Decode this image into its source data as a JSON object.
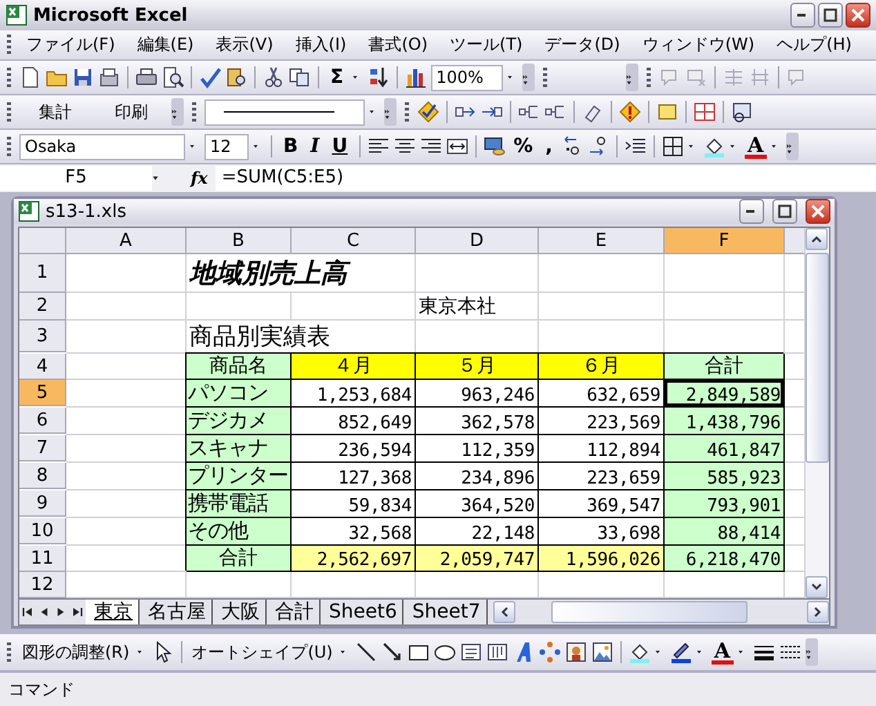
{
  "window": {
    "title": "Microsoft Excel"
  },
  "menu": [
    {
      "label": "ファイル(F)"
    },
    {
      "label": "編集(E)"
    },
    {
      "label": "表示(V)"
    },
    {
      "label": "挿入(I)"
    },
    {
      "label": "書式(O)"
    },
    {
      "label": "ツール(T)"
    },
    {
      "label": "データ(D)"
    },
    {
      "label": "ウィンドウ(W)"
    },
    {
      "label": "ヘルプ(H)"
    }
  ],
  "standard_toolbar": {
    "autosum": "Σ",
    "zoom": "100%"
  },
  "custom_toolbar": {
    "buttons": [
      "集計",
      "印刷"
    ]
  },
  "formatting_toolbar": {
    "font": "Osaka",
    "size": "12",
    "style_buttons": [
      "B",
      "I",
      "U"
    ],
    "percent": "%",
    "comma": ",",
    "font_color": "A"
  },
  "formula_bar": {
    "name_box": "F5",
    "fx": "fx",
    "formula": "=SUM(C5:E5)"
  },
  "workbook": {
    "title": "s13-1.xls",
    "columns": [
      {
        "label": "A",
        "selected": false
      },
      {
        "label": "B",
        "selected": false
      },
      {
        "label": "C",
        "selected": false
      },
      {
        "label": "D",
        "selected": false
      },
      {
        "label": "E",
        "selected": false
      },
      {
        "label": "F",
        "selected": true
      }
    ],
    "rows": [
      {
        "header": "1",
        "selected": false,
        "cells": [
          null,
          {
            "text": "地域別売上高",
            "kind": "title"
          },
          null,
          null,
          null,
          null
        ]
      },
      {
        "header": "2",
        "selected": false,
        "cells": [
          null,
          null,
          null,
          {
            "text": "東京本社",
            "kind": "text"
          },
          null,
          null
        ]
      },
      {
        "header": "3",
        "selected": false,
        "cells": [
          null,
          {
            "text": "商品別実績表",
            "kind": "subtitle"
          },
          null,
          null,
          null,
          null
        ]
      },
      {
        "header": "4",
        "selected": false,
        "cells": [
          null,
          {
            "text": "商品名",
            "kind": "heading",
            "color": "#ccffcc"
          },
          {
            "text": "４月",
            "kind": "heading",
            "color": "#ffff00"
          },
          {
            "text": "５月",
            "kind": "heading",
            "color": "#ffff00"
          },
          {
            "text": "６月",
            "kind": "heading",
            "color": "#ffff00"
          },
          {
            "text": "合計",
            "kind": "heading",
            "color": "#ccffcc"
          }
        ]
      },
      {
        "header": "5",
        "selected": true,
        "cells": [
          null,
          {
            "text": "パソコン",
            "kind": "label",
            "color": "#ccffcc"
          },
          {
            "text": "1,253,684",
            "kind": "number"
          },
          {
            "text": "963,246",
            "kind": "number"
          },
          {
            "text": "632,659",
            "kind": "number"
          },
          {
            "text": "2,849,589",
            "kind": "number",
            "color": "#ccffcc"
          }
        ]
      },
      {
        "header": "6",
        "selected": false,
        "cells": [
          null,
          {
            "text": "デジカメ",
            "kind": "label",
            "color": "#ccffcc"
          },
          {
            "text": "852,649",
            "kind": "number"
          },
          {
            "text": "362,578",
            "kind": "number"
          },
          {
            "text": "223,569",
            "kind": "number"
          },
          {
            "text": "1,438,796",
            "kind": "number",
            "color": "#ccffcc"
          }
        ]
      },
      {
        "header": "7",
        "selected": false,
        "cells": [
          null,
          {
            "text": "スキャナ",
            "kind": "label",
            "color": "#ccffcc"
          },
          {
            "text": "236,594",
            "kind": "number"
          },
          {
            "text": "112,359",
            "kind": "number"
          },
          {
            "text": "112,894",
            "kind": "number"
          },
          {
            "text": "461,847",
            "kind": "number",
            "color": "#ccffcc"
          }
        ]
      },
      {
        "header": "8",
        "selected": false,
        "cells": [
          null,
          {
            "text": "プリンター",
            "kind": "label",
            "color": "#ccffcc"
          },
          {
            "text": "127,368",
            "kind": "number"
          },
          {
            "text": "234,896",
            "kind": "number"
          },
          {
            "text": "223,659",
            "kind": "number"
          },
          {
            "text": "585,923",
            "kind": "number",
            "color": "#ccffcc"
          }
        ]
      },
      {
        "header": "9",
        "selected": false,
        "cells": [
          null,
          {
            "text": "携帯電話",
            "kind": "label",
            "color": "#ccffcc"
          },
          {
            "text": "59,834",
            "kind": "number"
          },
          {
            "text": "364,520",
            "kind": "number"
          },
          {
            "text": "369,547",
            "kind": "number"
          },
          {
            "text": "793,901",
            "kind": "number",
            "color": "#ccffcc"
          }
        ]
      },
      {
        "header": "10",
        "selected": false,
        "cells": [
          null,
          {
            "text": "その他",
            "kind": "label",
            "color": "#ccffcc"
          },
          {
            "text": "32,568",
            "kind": "number"
          },
          {
            "text": "22,148",
            "kind": "number"
          },
          {
            "text": "33,698",
            "kind": "number"
          },
          {
            "text": "88,414",
            "kind": "number",
            "color": "#ccffcc"
          }
        ]
      },
      {
        "header": "11",
        "selected": false,
        "cells": [
          null,
          {
            "text": "合計",
            "kind": "heading",
            "color": "#ccffcc"
          },
          {
            "text": "2,562,697",
            "kind": "number",
            "color": "#ffff99"
          },
          {
            "text": "2,059,747",
            "kind": "number",
            "color": "#ffff99"
          },
          {
            "text": "1,596,026",
            "kind": "number",
            "color": "#ffff99"
          },
          {
            "text": "6,218,470",
            "kind": "number",
            "color": "#ccffcc"
          }
        ]
      },
      {
        "header": "12",
        "selected": false,
        "cells": [
          null,
          null,
          null,
          null,
          null,
          null
        ]
      }
    ],
    "sheet_tabs": [
      {
        "label": "東京",
        "selected": true
      },
      {
        "label": "名古屋",
        "selected": false
      },
      {
        "label": "大阪",
        "selected": false
      },
      {
        "label": "合計",
        "selected": false
      },
      {
        "label": "Sheet6",
        "selected": false
      },
      {
        "label": "Sheet7",
        "selected": false
      }
    ]
  },
  "drawing_toolbar": {
    "draw_menu": "図形の調整(R)",
    "autoshapes_menu": "オートシェイプ(U)",
    "font_color": "A"
  },
  "status_bar": {
    "text": "コマンド"
  }
}
